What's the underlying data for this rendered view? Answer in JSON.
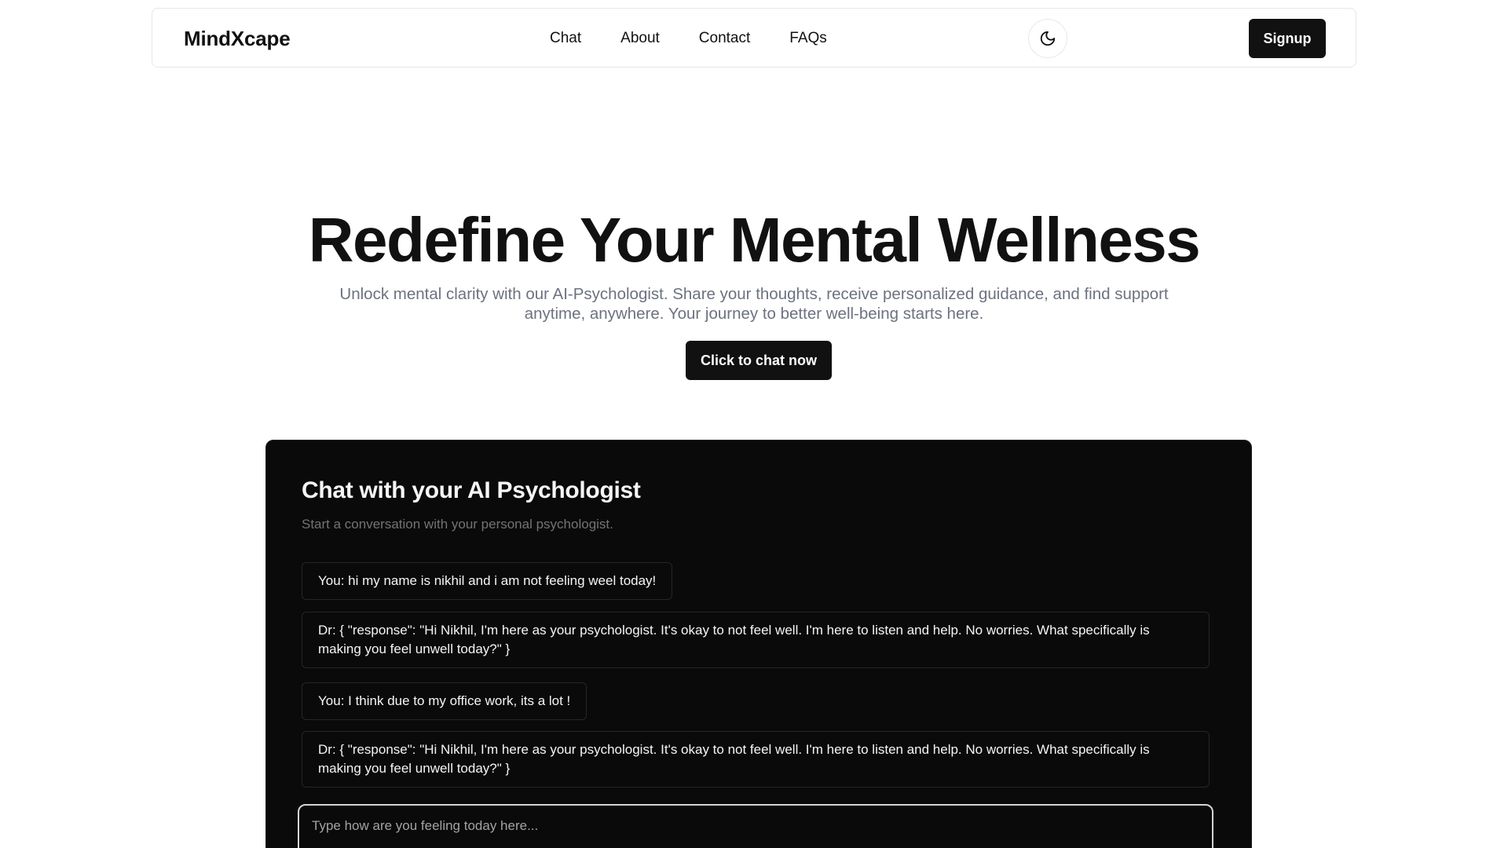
{
  "navbar": {
    "brand": "MindXcape",
    "links": [
      "Chat",
      "About",
      "Contact",
      "FAQs"
    ],
    "theme_toggle_icon": "moon-icon",
    "signup_label": "Signup"
  },
  "hero": {
    "title": "Redefine Your Mental Wellness",
    "subtitle_line1": "Unlock mental clarity with our AI-Psychologist. Share your thoughts, receive personalized guidance, and find support",
    "subtitle_line2": "anytime, anywhere. Your journey to better well-being starts here.",
    "cta_label": "Click to chat now"
  },
  "chat": {
    "title": "Chat with your AI Psychologist",
    "description": "Start a conversation with your personal psychologist.",
    "messages": [
      "You: hi my name is nikhil and i am not feeling weel today!",
      "Dr: { \"response\": \"Hi Nikhil, I'm here as your psychologist. It's okay to not feel well. I'm here to listen and help. No worries. What specifically is making you feel unwell today?\" }",
      "You: I think due to my office work, its a lot !",
      "Dr: { \"response\": \"Hi Nikhil, I'm here as your psychologist. It's okay to not feel well. I'm here to listen and help. No worries. What specifically is making you feel unwell today?\" }"
    ],
    "input_placeholder": "Type how are you feeling today here..."
  },
  "colors": {
    "primary": "#111111",
    "muted_text": "#6b7280",
    "card_bg": "#0a0a0a"
  }
}
